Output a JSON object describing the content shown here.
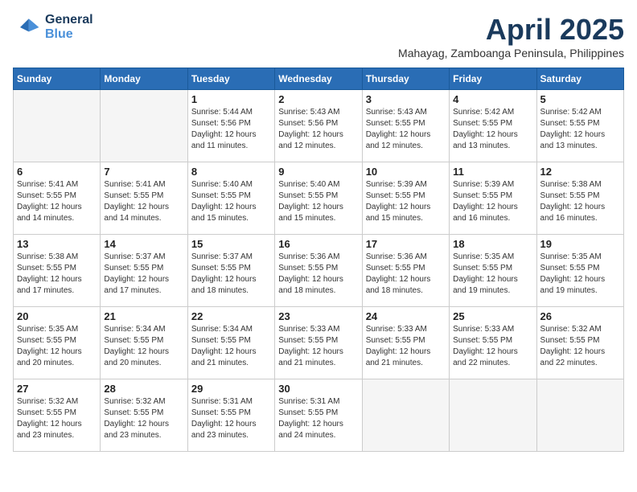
{
  "header": {
    "logo_line1": "General",
    "logo_line2": "Blue",
    "month_title": "April 2025",
    "subtitle": "Mahayag, Zamboanga Peninsula, Philippines"
  },
  "days_of_week": [
    "Sunday",
    "Monday",
    "Tuesday",
    "Wednesday",
    "Thursday",
    "Friday",
    "Saturday"
  ],
  "weeks": [
    [
      {
        "day": null,
        "sunrise": null,
        "sunset": null,
        "daylight": null
      },
      {
        "day": null,
        "sunrise": null,
        "sunset": null,
        "daylight": null
      },
      {
        "day": "1",
        "sunrise": "Sunrise: 5:44 AM",
        "sunset": "Sunset: 5:56 PM",
        "daylight": "Daylight: 12 hours and 11 minutes."
      },
      {
        "day": "2",
        "sunrise": "Sunrise: 5:43 AM",
        "sunset": "Sunset: 5:56 PM",
        "daylight": "Daylight: 12 hours and 12 minutes."
      },
      {
        "day": "3",
        "sunrise": "Sunrise: 5:43 AM",
        "sunset": "Sunset: 5:55 PM",
        "daylight": "Daylight: 12 hours and 12 minutes."
      },
      {
        "day": "4",
        "sunrise": "Sunrise: 5:42 AM",
        "sunset": "Sunset: 5:55 PM",
        "daylight": "Daylight: 12 hours and 13 minutes."
      },
      {
        "day": "5",
        "sunrise": "Sunrise: 5:42 AM",
        "sunset": "Sunset: 5:55 PM",
        "daylight": "Daylight: 12 hours and 13 minutes."
      }
    ],
    [
      {
        "day": "6",
        "sunrise": "Sunrise: 5:41 AM",
        "sunset": "Sunset: 5:55 PM",
        "daylight": "Daylight: 12 hours and 14 minutes."
      },
      {
        "day": "7",
        "sunrise": "Sunrise: 5:41 AM",
        "sunset": "Sunset: 5:55 PM",
        "daylight": "Daylight: 12 hours and 14 minutes."
      },
      {
        "day": "8",
        "sunrise": "Sunrise: 5:40 AM",
        "sunset": "Sunset: 5:55 PM",
        "daylight": "Daylight: 12 hours and 15 minutes."
      },
      {
        "day": "9",
        "sunrise": "Sunrise: 5:40 AM",
        "sunset": "Sunset: 5:55 PM",
        "daylight": "Daylight: 12 hours and 15 minutes."
      },
      {
        "day": "10",
        "sunrise": "Sunrise: 5:39 AM",
        "sunset": "Sunset: 5:55 PM",
        "daylight": "Daylight: 12 hours and 15 minutes."
      },
      {
        "day": "11",
        "sunrise": "Sunrise: 5:39 AM",
        "sunset": "Sunset: 5:55 PM",
        "daylight": "Daylight: 12 hours and 16 minutes."
      },
      {
        "day": "12",
        "sunrise": "Sunrise: 5:38 AM",
        "sunset": "Sunset: 5:55 PM",
        "daylight": "Daylight: 12 hours and 16 minutes."
      }
    ],
    [
      {
        "day": "13",
        "sunrise": "Sunrise: 5:38 AM",
        "sunset": "Sunset: 5:55 PM",
        "daylight": "Daylight: 12 hours and 17 minutes."
      },
      {
        "day": "14",
        "sunrise": "Sunrise: 5:37 AM",
        "sunset": "Sunset: 5:55 PM",
        "daylight": "Daylight: 12 hours and 17 minutes."
      },
      {
        "day": "15",
        "sunrise": "Sunrise: 5:37 AM",
        "sunset": "Sunset: 5:55 PM",
        "daylight": "Daylight: 12 hours and 18 minutes."
      },
      {
        "day": "16",
        "sunrise": "Sunrise: 5:36 AM",
        "sunset": "Sunset: 5:55 PM",
        "daylight": "Daylight: 12 hours and 18 minutes."
      },
      {
        "day": "17",
        "sunrise": "Sunrise: 5:36 AM",
        "sunset": "Sunset: 5:55 PM",
        "daylight": "Daylight: 12 hours and 18 minutes."
      },
      {
        "day": "18",
        "sunrise": "Sunrise: 5:35 AM",
        "sunset": "Sunset: 5:55 PM",
        "daylight": "Daylight: 12 hours and 19 minutes."
      },
      {
        "day": "19",
        "sunrise": "Sunrise: 5:35 AM",
        "sunset": "Sunset: 5:55 PM",
        "daylight": "Daylight: 12 hours and 19 minutes."
      }
    ],
    [
      {
        "day": "20",
        "sunrise": "Sunrise: 5:35 AM",
        "sunset": "Sunset: 5:55 PM",
        "daylight": "Daylight: 12 hours and 20 minutes."
      },
      {
        "day": "21",
        "sunrise": "Sunrise: 5:34 AM",
        "sunset": "Sunset: 5:55 PM",
        "daylight": "Daylight: 12 hours and 20 minutes."
      },
      {
        "day": "22",
        "sunrise": "Sunrise: 5:34 AM",
        "sunset": "Sunset: 5:55 PM",
        "daylight": "Daylight: 12 hours and 21 minutes."
      },
      {
        "day": "23",
        "sunrise": "Sunrise: 5:33 AM",
        "sunset": "Sunset: 5:55 PM",
        "daylight": "Daylight: 12 hours and 21 minutes."
      },
      {
        "day": "24",
        "sunrise": "Sunrise: 5:33 AM",
        "sunset": "Sunset: 5:55 PM",
        "daylight": "Daylight: 12 hours and 21 minutes."
      },
      {
        "day": "25",
        "sunrise": "Sunrise: 5:33 AM",
        "sunset": "Sunset: 5:55 PM",
        "daylight": "Daylight: 12 hours and 22 minutes."
      },
      {
        "day": "26",
        "sunrise": "Sunrise: 5:32 AM",
        "sunset": "Sunset: 5:55 PM",
        "daylight": "Daylight: 12 hours and 22 minutes."
      }
    ],
    [
      {
        "day": "27",
        "sunrise": "Sunrise: 5:32 AM",
        "sunset": "Sunset: 5:55 PM",
        "daylight": "Daylight: 12 hours and 23 minutes."
      },
      {
        "day": "28",
        "sunrise": "Sunrise: 5:32 AM",
        "sunset": "Sunset: 5:55 PM",
        "daylight": "Daylight: 12 hours and 23 minutes."
      },
      {
        "day": "29",
        "sunrise": "Sunrise: 5:31 AM",
        "sunset": "Sunset: 5:55 PM",
        "daylight": "Daylight: 12 hours and 23 minutes."
      },
      {
        "day": "30",
        "sunrise": "Sunrise: 5:31 AM",
        "sunset": "Sunset: 5:55 PM",
        "daylight": "Daylight: 12 hours and 24 minutes."
      },
      {
        "day": null,
        "sunrise": null,
        "sunset": null,
        "daylight": null
      },
      {
        "day": null,
        "sunrise": null,
        "sunset": null,
        "daylight": null
      },
      {
        "day": null,
        "sunrise": null,
        "sunset": null,
        "daylight": null
      }
    ]
  ]
}
